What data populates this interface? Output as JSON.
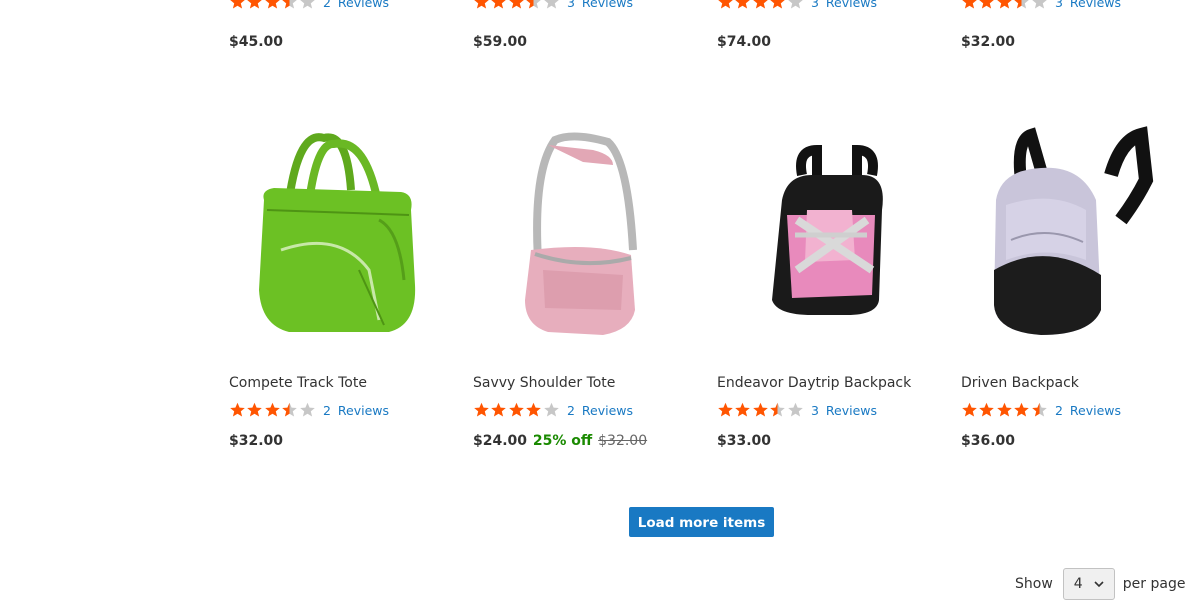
{
  "top_row": [
    {
      "rating": 3.5,
      "reviews_count": "2",
      "reviews_label": "Reviews",
      "price": "$45.00"
    },
    {
      "rating": 3.5,
      "reviews_count": "3",
      "reviews_label": "Reviews",
      "price": "$59.00"
    },
    {
      "rating": 4,
      "reviews_count": "3",
      "reviews_label": "Reviews",
      "price": "$74.00"
    },
    {
      "rating": 3.5,
      "reviews_count": "3",
      "reviews_label": "Reviews",
      "price": "$32.00"
    }
  ],
  "products": [
    {
      "name": "Compete Track Tote",
      "image": "green-tote-bag",
      "rating": 3.5,
      "reviews_count": "2",
      "reviews_label": "Reviews",
      "price": "$32.00",
      "discount": "",
      "old_price": ""
    },
    {
      "name": "Savvy Shoulder Tote",
      "image": "pink-shoulder-bag",
      "rating": 4,
      "reviews_count": "2",
      "reviews_label": "Reviews",
      "price": "$24.00",
      "discount": "25% off",
      "old_price": "$32.00"
    },
    {
      "name": "Endeavor Daytrip Backpack",
      "image": "pink-black-backpack",
      "rating": 3.5,
      "reviews_count": "3",
      "reviews_label": "Reviews",
      "price": "$33.00",
      "discount": "",
      "old_price": ""
    },
    {
      "name": "Driven Backpack",
      "image": "lavender-black-backpack",
      "rating": 4.5,
      "reviews_count": "2",
      "reviews_label": "Reviews",
      "price": "$36.00",
      "discount": "",
      "old_price": ""
    }
  ],
  "load_more_label": "Load more items",
  "pager": {
    "show_label": "Show",
    "limit_value": "4",
    "per_page_label": "per page"
  },
  "colors": {
    "star_filled": "#ff5501",
    "star_empty": "#c7c7c7",
    "link": "#1979c3",
    "button": "#1979c3",
    "discount": "#1a8a00"
  }
}
